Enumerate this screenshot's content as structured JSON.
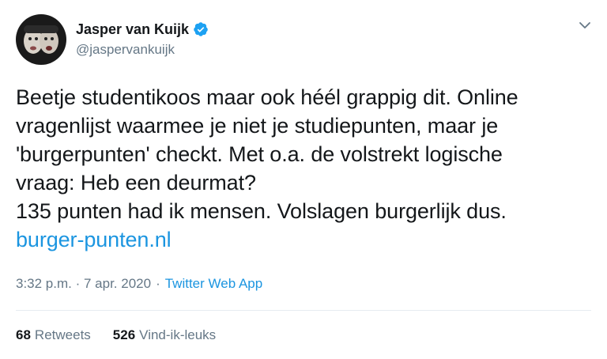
{
  "tweet": {
    "author": {
      "display_name": "Jasper van Kuijk",
      "handle": "@jaspervankuijk",
      "avatar_icon": "person-avatar",
      "verified_icon": "verified-badge-icon",
      "verified_color": "#1da1f2"
    },
    "menu_icon": "chevron-down-icon",
    "text_lines": [
      "Beetje studentikoos maar ook héél grappig dit. Online",
      "vragenlijst waarmee je niet je studiepunten, maar je",
      "'burgerpunten' checkt. Met o.a. de volstrekt logische",
      "vraag: Heb een deurmat?",
      "135 punten had ik mensen. Volslagen burgerlijk dus."
    ],
    "link": "burger-punten.nl",
    "timestamp": "3:32 p.m. · 7 apr. 2020",
    "separator": "·",
    "source": "Twitter Web App",
    "retweets": {
      "count": "68",
      "label": "Retweets"
    },
    "likes": {
      "count": "526",
      "label": "Vind-ik-leuks"
    },
    "colors": {
      "link": "#1b95e0",
      "secondary_text": "#657786",
      "primary_text": "#14171a",
      "divider": "#e6ecf0"
    }
  }
}
